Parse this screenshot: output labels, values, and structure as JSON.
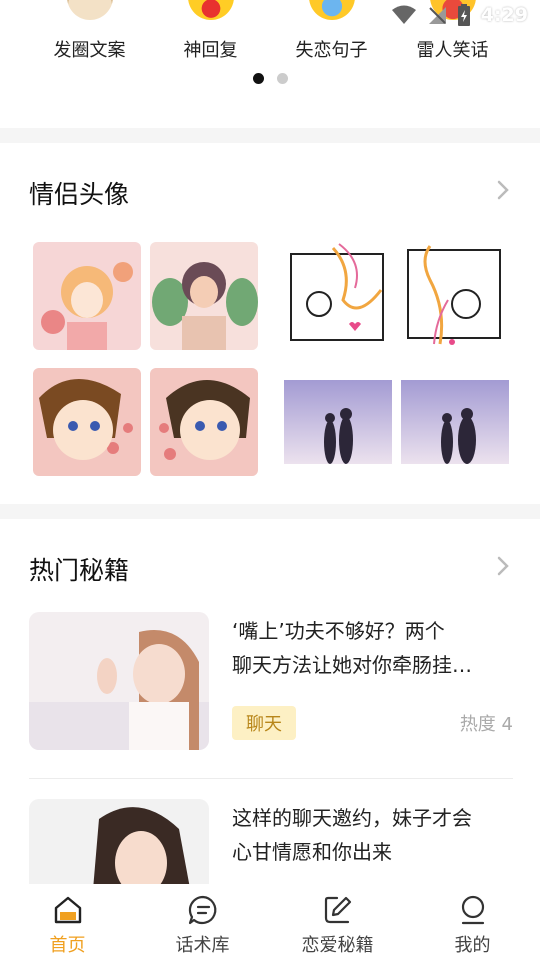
{
  "status_bar": {
    "time": "4:29"
  },
  "categories": [
    {
      "label": "发圈文案",
      "icon": "cat-emoji-icon"
    },
    {
      "label": "神回复",
      "icon": "cat-emoji-icon"
    },
    {
      "label": "失恋句子",
      "icon": "cat-emoji-icon"
    },
    {
      "label": "雷人笑话",
      "icon": "cat-emoji-icon"
    }
  ],
  "carousel": {
    "pages": 2,
    "active": 0
  },
  "couple_avatars": {
    "title": "情侣头像",
    "sets": [
      "anime-girl-boy-floral",
      "doodle-love-note",
      "detective-couple-hearts",
      "sunset-silhouette-couple"
    ]
  },
  "hot_tips": {
    "title": "热门秘籍",
    "articles": [
      {
        "title_line1": "‘嘴上’功夫不够好？两个",
        "title_line2": "聊天方法让她对你牵肠挂…",
        "tag": "聊天",
        "heat": "热度 4"
      },
      {
        "title_line1": "这样的聊天邀约，妹子才会",
        "title_line2": "心甘情愿和你出来",
        "tag": "",
        "heat": ""
      }
    ]
  },
  "bottom_nav": {
    "items": [
      {
        "label": "首页"
      },
      {
        "label": "话术库"
      },
      {
        "label": "恋爱秘籍"
      },
      {
        "label": "我的"
      }
    ],
    "active_index": 0
  },
  "colors": {
    "accent": "#f0a020",
    "tag_bg": "#fdf0c4",
    "tag_text": "#b8861a"
  }
}
